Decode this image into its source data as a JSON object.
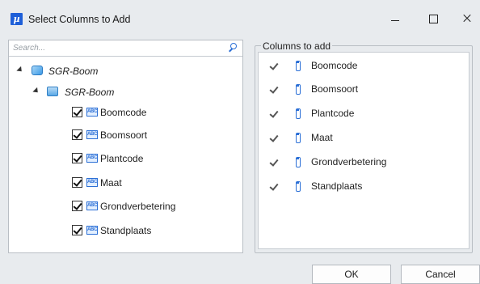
{
  "window": {
    "title": "Select Columns to Add",
    "app_icon_glyph": "µ",
    "app_icon_color": "#1e5fd8"
  },
  "search": {
    "placeholder": "Search..."
  },
  "tree": {
    "root_label": "SGR-Boom",
    "table_label": "SGR-Boom",
    "fields": [
      {
        "label": "Boomcode",
        "checked": true
      },
      {
        "label": "Boomsoort",
        "checked": true
      },
      {
        "label": "Plantcode",
        "checked": true
      },
      {
        "label": "Maat",
        "checked": true
      },
      {
        "label": "Grondverbetering",
        "checked": true
      },
      {
        "label": "Standplaats",
        "checked": true
      }
    ],
    "field_icon_text": "ABC"
  },
  "columns_to_add": {
    "caption": "Columns to add",
    "items": [
      {
        "label": "Boomcode",
        "checked": true
      },
      {
        "label": "Boomsoort",
        "checked": true
      },
      {
        "label": "Plantcode",
        "checked": true
      },
      {
        "label": "Maat",
        "checked": true
      },
      {
        "label": "Grondverbetering",
        "checked": true
      },
      {
        "label": "Standplaats",
        "checked": true
      }
    ]
  },
  "buttons": {
    "ok": "OK",
    "cancel": "Cancel"
  },
  "colors": {
    "accent": "#2b6fd6",
    "window_bg": "#e8ebee"
  }
}
